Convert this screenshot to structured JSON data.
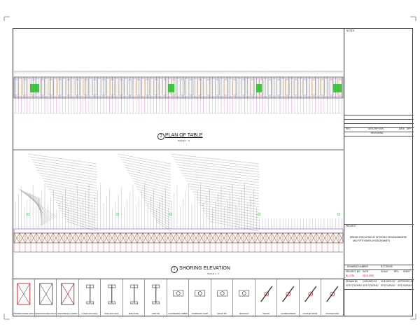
{
  "plan": {
    "title": "PLAN OF TABLE",
    "number": "2",
    "scale": "SCALE 1 : X"
  },
  "elevation": {
    "title": "SHORING ELEVATION",
    "number": "1",
    "scale": "SCALE 1 : X"
  },
  "title_block": {
    "notes_label": "NOTES:",
    "rev_header": [
      "REV",
      "DESCRIPTION",
      "DATE",
      "APP"
    ],
    "revisions_label": "REVISIONS",
    "project_label": "PROJECT",
    "project_text": [
      "BRIDGE EXECUTION AT INTERSECTION/DAVANGERE",
      "AND FIFTH MAKKA ROAD/(NAMEY)"
    ],
    "drawing_number_label": "DRAWING NUMBER",
    "drawing_number_value": "BT-7200/08",
    "row1_labels": [
      "PROJECT NO",
      "DATE",
      "SCALE",
      "REV",
      "SHEET"
    ],
    "row1_values": [
      "BL-1736",
      "01.05.2009",
      "",
      "",
      ""
    ],
    "row2_labels": [
      "DRAWN BY",
      "CHECKED BY",
      "CHECKED BY",
      "APPROVED BY"
    ],
    "row2_values": [
      "SITE STUDENT",
      "SITE STUDENT",
      "SITE SURVEY",
      "SITE SURVEY"
    ],
    "accent": "#c00000"
  },
  "legend": [
    {
      "caption": "STANDARD FRAME 1200x1700"
    },
    {
      "caption": "TRANSOM FRAME 1200x1700"
    },
    {
      "caption": "CROSS BRACE (2 SIDES)"
    },
    {
      "caption": "U-HEAD JACK (ADJ)"
    },
    {
      "caption": "BASE JACK (ADJ)"
    },
    {
      "caption": "BASE PLATE"
    },
    {
      "caption": "JOINT PIN"
    },
    {
      "caption": "LOAD BEARING TIMBER"
    },
    {
      "caption": "FORMWORK CLAMP"
    },
    {
      "caption": "SPIGOT PIN"
    },
    {
      "caption": "HOOK BOLT"
    },
    {
      "caption": "TIE ROD"
    },
    {
      "caption": "ALUMINIUM BEAM"
    },
    {
      "caption": "COUPLER SWIVEL"
    },
    {
      "caption": "COUPLER FIXED"
    }
  ],
  "colors": {
    "frame": "#333333",
    "green": "#22c022",
    "purple": "#8844cc",
    "orange": "#d98a20",
    "magenta": "#cc33cc",
    "red": "#cc0000"
  }
}
